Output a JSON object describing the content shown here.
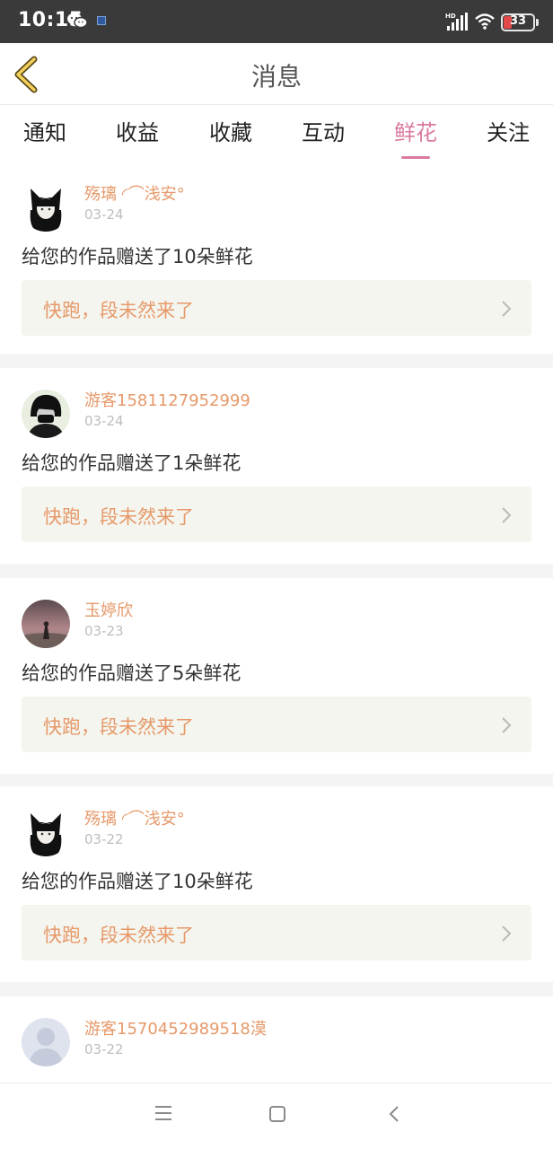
{
  "status_bar": {
    "time": "10:15",
    "battery": "33",
    "network_label": "HD"
  },
  "header": {
    "title": "消息",
    "back_icon": "chevron-left-icon"
  },
  "tabs": [
    {
      "label": "通知",
      "active": false
    },
    {
      "label": "收益",
      "active": false
    },
    {
      "label": "收藏",
      "active": false
    },
    {
      "label": "互动",
      "active": false
    },
    {
      "label": "鲜花",
      "active": true
    },
    {
      "label": "关注",
      "active": false
    }
  ],
  "messages": [
    {
      "user": "殇璃 ◜⌒浅安°",
      "date": "03-24",
      "text": "给您的作品赠送了10朵鲜花",
      "work": "快跑，段未然来了",
      "avatar": "avatar-black-cat-girl"
    },
    {
      "user": "游客1581127952999",
      "date": "03-24",
      "text": "给您的作品赠送了1朵鲜花",
      "work": "快跑，段未然来了",
      "avatar": "avatar-masked-boy"
    },
    {
      "user": "玉婷欣",
      "date": "03-23",
      "text": "给您的作品赠送了5朵鲜花",
      "work": "快跑，段未然来了",
      "avatar": "avatar-sunset-figure"
    },
    {
      "user": "殇璃 ◜⌒浅安°",
      "date": "03-22",
      "text": "给您的作品赠送了10朵鲜花",
      "work": "快跑，段未然来了",
      "avatar": "avatar-black-cat-girl"
    },
    {
      "user": "游客1570452989518漠",
      "date": "03-22",
      "text": "",
      "work": "",
      "avatar": "avatar-default-person"
    }
  ],
  "colors": {
    "accent_pink": "#d97aa0",
    "username_orange": "#e6996a",
    "link_bg": "#f4f5ee",
    "separator": "#f5f4f4"
  },
  "nav": [
    "menu-icon",
    "home-square-icon",
    "back-icon"
  ]
}
